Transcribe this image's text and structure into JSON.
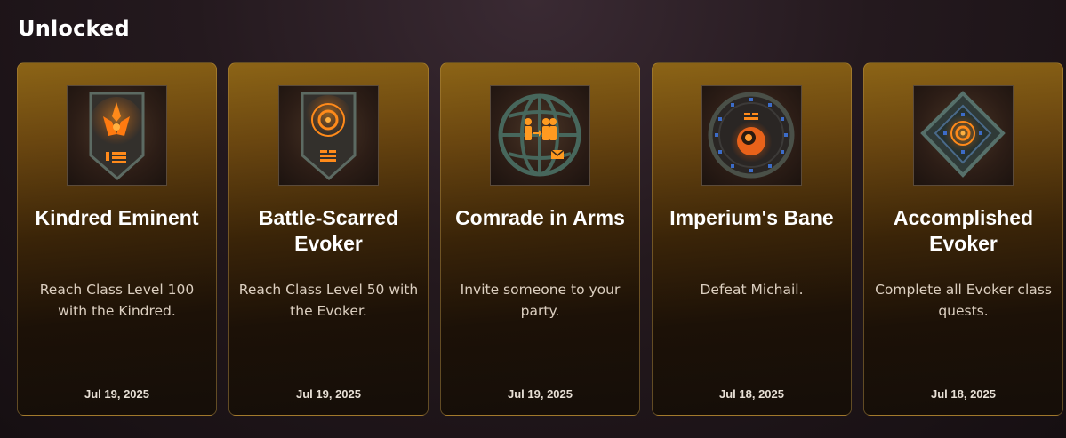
{
  "section": {
    "title": "Unlocked"
  },
  "colors": {
    "accent_gold": "#8c6416",
    "icon_glow": "#ff7a10"
  },
  "achievements": [
    {
      "title": "Kindred Eminent",
      "description": "Reach Class Level 100 with the Kindred.",
      "date": "Jul 19, 2025",
      "icon": "kindred-shield-icon"
    },
    {
      "title": "Battle-Scarred Evoker",
      "description": "Reach Class Level 50 with the Evoker.",
      "date": "Jul 19, 2025",
      "icon": "evoker-shield-icon"
    },
    {
      "title": "Comrade in Arms",
      "description": "Invite someone to your party.",
      "date": "Jul 19, 2025",
      "icon": "party-globe-icon"
    },
    {
      "title": "Imperium's Bane",
      "description": "Defeat Michail.",
      "date": "Jul 18, 2025",
      "icon": "imperium-seal-icon"
    },
    {
      "title": "Accomplished Evoker",
      "description": "Complete all Evoker class quests.",
      "date": "Jul 18, 2025",
      "icon": "evoker-diamond-icon"
    }
  ]
}
